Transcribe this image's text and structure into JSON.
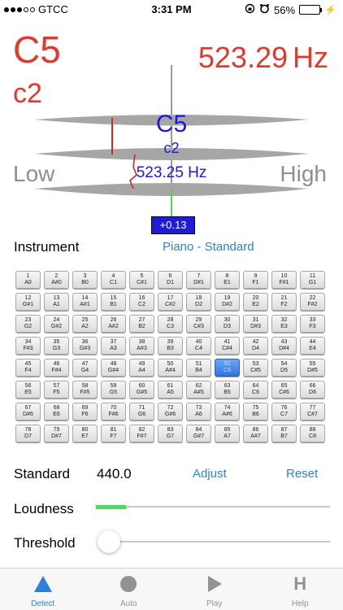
{
  "status": {
    "carrier": "GTCC",
    "time": "3:31 PM",
    "battery": "56%",
    "battery_level": 0.56
  },
  "tuner": {
    "detected_note": "C5",
    "detected_octave": "c2",
    "detected_freq": "523.29",
    "freq_unit": "Hz",
    "target_note": "C5",
    "target_octave": "c2",
    "target_freq": "523.25 Hz",
    "low_label": "Low",
    "high_label": "High",
    "cents": "+0.13",
    "colors": {
      "detected": "#e03a2f",
      "target": "#1a17e6",
      "cents_bg": "#1e1bd9"
    }
  },
  "instrument": {
    "label": "Instrument",
    "value": "Piano - Standard"
  },
  "keys": [
    {
      "num": "1",
      "note": "A0"
    },
    {
      "num": "2",
      "note": "A#0"
    },
    {
      "num": "3",
      "note": "B0"
    },
    {
      "num": "4",
      "note": "C1"
    },
    {
      "num": "5",
      "note": "C#1"
    },
    {
      "num": "6",
      "note": "D1"
    },
    {
      "num": "7",
      "note": "D#1"
    },
    {
      "num": "8",
      "note": "E1"
    },
    {
      "num": "9",
      "note": "F1"
    },
    {
      "num": "10",
      "note": "F#1"
    },
    {
      "num": "11",
      "note": "G1"
    },
    {
      "num": "12",
      "note": "G#1"
    },
    {
      "num": "13",
      "note": "A1"
    },
    {
      "num": "14",
      "note": "A#1"
    },
    {
      "num": "15",
      "note": "B1"
    },
    {
      "num": "16",
      "note": "C2"
    },
    {
      "num": "17",
      "note": "C#2"
    },
    {
      "num": "18",
      "note": "D2"
    },
    {
      "num": "19",
      "note": "D#2"
    },
    {
      "num": "20",
      "note": "E2"
    },
    {
      "num": "21",
      "note": "F2"
    },
    {
      "num": "22",
      "note": "F#2"
    },
    {
      "num": "23",
      "note": "G2"
    },
    {
      "num": "24",
      "note": "G#2"
    },
    {
      "num": "25",
      "note": "A2"
    },
    {
      "num": "26",
      "note": "A#2"
    },
    {
      "num": "27",
      "note": "B2"
    },
    {
      "num": "28",
      "note": "C3"
    },
    {
      "num": "29",
      "note": "C#3"
    },
    {
      "num": "30",
      "note": "D3"
    },
    {
      "num": "31",
      "note": "D#3"
    },
    {
      "num": "32",
      "note": "E3"
    },
    {
      "num": "33",
      "note": "F3"
    },
    {
      "num": "34",
      "note": "F#3"
    },
    {
      "num": "35",
      "note": "G3"
    },
    {
      "num": "36",
      "note": "G#3"
    },
    {
      "num": "37",
      "note": "A3"
    },
    {
      "num": "38",
      "note": "A#3"
    },
    {
      "num": "39",
      "note": "B3"
    },
    {
      "num": "40",
      "note": "C4"
    },
    {
      "num": "41",
      "note": "C#4"
    },
    {
      "num": "42",
      "note": "D4"
    },
    {
      "num": "43",
      "note": "D#4"
    },
    {
      "num": "44",
      "note": "E4"
    },
    {
      "num": "45",
      "note": "F4"
    },
    {
      "num": "46",
      "note": "F#4"
    },
    {
      "num": "47",
      "note": "G4"
    },
    {
      "num": "48",
      "note": "G#4"
    },
    {
      "num": "49",
      "note": "A4"
    },
    {
      "num": "50",
      "note": "A#4"
    },
    {
      "num": "51",
      "note": "B4"
    },
    {
      "num": "52",
      "note": "C5",
      "active": true
    },
    {
      "num": "53",
      "note": "C#5"
    },
    {
      "num": "54",
      "note": "D5"
    },
    {
      "num": "55",
      "note": "D#5"
    },
    {
      "num": "56",
      "note": "E5"
    },
    {
      "num": "57",
      "note": "F5"
    },
    {
      "num": "58",
      "note": "F#5"
    },
    {
      "num": "59",
      "note": "G5"
    },
    {
      "num": "60",
      "note": "G#5"
    },
    {
      "num": "61",
      "note": "A5"
    },
    {
      "num": "62",
      "note": "A#5"
    },
    {
      "num": "63",
      "note": "B5"
    },
    {
      "num": "64",
      "note": "C6"
    },
    {
      "num": "65",
      "note": "C#6"
    },
    {
      "num": "66",
      "note": "D6"
    },
    {
      "num": "67",
      "note": "D#6"
    },
    {
      "num": "68",
      "note": "E6"
    },
    {
      "num": "69",
      "note": "F6"
    },
    {
      "num": "70",
      "note": "F#6"
    },
    {
      "num": "71",
      "note": "G6"
    },
    {
      "num": "72",
      "note": "G#6"
    },
    {
      "num": "73",
      "note": "A6"
    },
    {
      "num": "74",
      "note": "A#6"
    },
    {
      "num": "75",
      "note": "B6"
    },
    {
      "num": "76",
      "note": "C7"
    },
    {
      "num": "77",
      "note": "C#7"
    },
    {
      "num": "78",
      "note": "D7"
    },
    {
      "num": "79",
      "note": "D#7"
    },
    {
      "num": "80",
      "note": "E7"
    },
    {
      "num": "81",
      "note": "F7"
    },
    {
      "num": "82",
      "note": "F#7"
    },
    {
      "num": "83",
      "note": "G7"
    },
    {
      "num": "84",
      "note": "G#7"
    },
    {
      "num": "85",
      "note": "A7"
    },
    {
      "num": "86",
      "note": "A#7"
    },
    {
      "num": "87",
      "note": "B7"
    },
    {
      "num": "88",
      "note": "C8"
    }
  ],
  "standard": {
    "label": "Standard",
    "value": "440.0",
    "adjust": "Adjust",
    "reset": "Reset"
  },
  "loudness": {
    "label": "Loudness",
    "level": 0.13
  },
  "threshold": {
    "label": "Threshold",
    "level": 0.0
  },
  "tabs": [
    {
      "label": "Detect",
      "icon": "triangle-icon",
      "active": true
    },
    {
      "label": "Auto",
      "icon": "circle-icon",
      "active": false
    },
    {
      "label": "Play",
      "icon": "play-icon",
      "active": false
    },
    {
      "label": "Help",
      "icon": "h-icon",
      "active": false
    }
  ],
  "accent": "#2f7fdc"
}
